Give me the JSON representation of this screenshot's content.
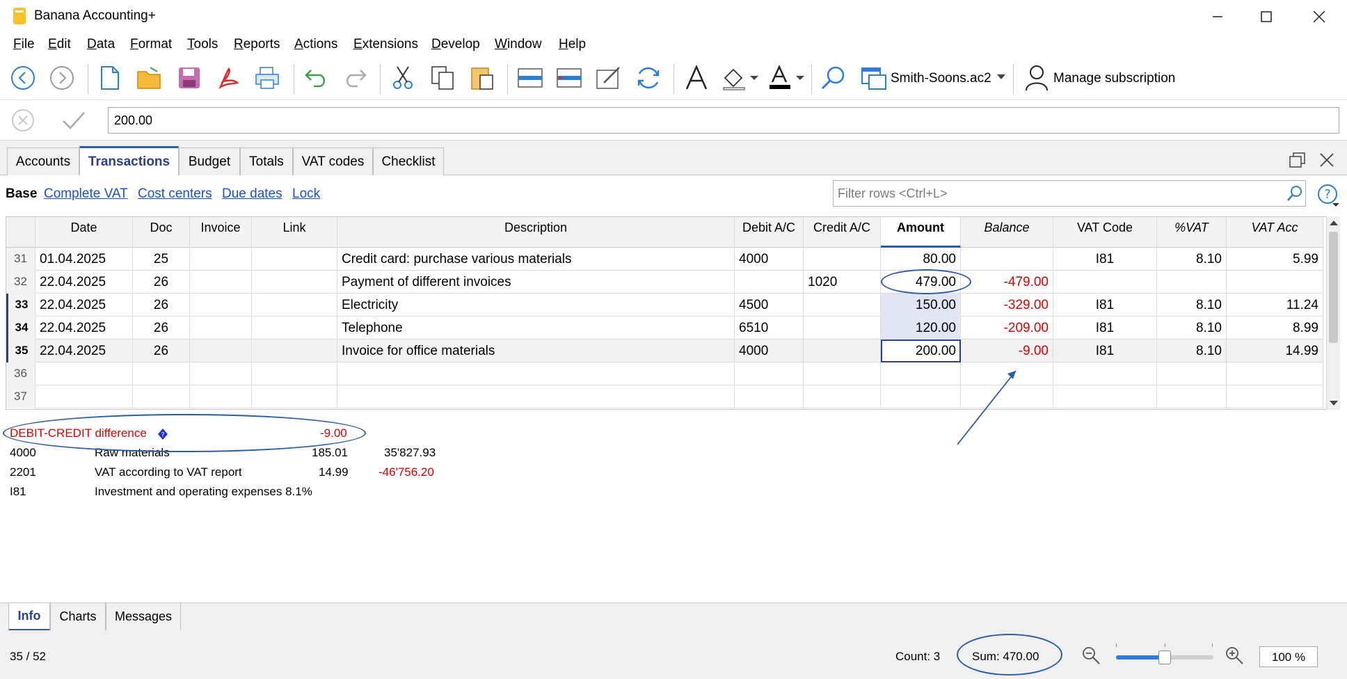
{
  "window": {
    "title": "Banana Accounting+"
  },
  "menu": [
    "File",
    "Edit",
    "Data",
    "Format",
    "Tools",
    "Reports",
    "Actions",
    "Extensions",
    "Develop",
    "Window",
    "Help"
  ],
  "toolbar": {
    "file_name": "Smith-Soons.ac2",
    "subscription": "Manage subscription"
  },
  "edit_value": "200.00",
  "tabs": [
    "Accounts",
    "Transactions",
    "Budget",
    "Totals",
    "VAT codes",
    "Checklist"
  ],
  "views": {
    "base": "Base",
    "links": [
      "Complete VAT",
      "Cost centers",
      "Due dates",
      "Lock"
    ]
  },
  "filter_placeholder": "Filter rows <Ctrl+L>",
  "table": {
    "columns": [
      "Date",
      "Doc",
      "Invoice",
      "Link",
      "Description",
      "Debit A/C",
      "Credit A/C",
      "Amount",
      "Balance",
      "VAT Code",
      "%VAT",
      "VAT Acc"
    ],
    "rows": [
      {
        "num": "31",
        "date": "01.04.2025",
        "doc": "25",
        "invoice": "",
        "link": "",
        "desc": "Credit card: purchase various materials",
        "debit": "4000",
        "credit": "",
        "amount": "80.00",
        "balance": "",
        "vat": "I81",
        "pct": "8.10",
        "vatacc": "5.99"
      },
      {
        "num": "32",
        "date": "22.04.2025",
        "doc": "26",
        "invoice": "",
        "link": "",
        "desc": "Payment of different invoices",
        "debit": "",
        "credit": "1020",
        "amount": "479.00",
        "balance": "-479.00",
        "vat": "",
        "pct": "",
        "vatacc": ""
      },
      {
        "num": "33",
        "date": "22.04.2025",
        "doc": "26",
        "invoice": "",
        "link": "",
        "desc": "Electricity",
        "debit": "4500",
        "credit": "",
        "amount": "150.00",
        "balance": "-329.00",
        "vat": "I81",
        "pct": "8.10",
        "vatacc": "11.24"
      },
      {
        "num": "34",
        "date": "22.04.2025",
        "doc": "26",
        "invoice": "",
        "link": "",
        "desc": "Telephone",
        "debit": "6510",
        "credit": "",
        "amount": "120.00",
        "balance": "-209.00",
        "vat": "I81",
        "pct": "8.10",
        "vatacc": "8.99"
      },
      {
        "num": "35",
        "date": "22.04.2025",
        "doc": "26",
        "invoice": "",
        "link": "",
        "desc": "Invoice for office materials",
        "debit": "4000",
        "credit": "",
        "amount": "200.00",
        "balance": "-9.00",
        "vat": "I81",
        "pct": "8.10",
        "vatacc": "14.99"
      },
      {
        "num": "36",
        "date": "",
        "doc": "",
        "invoice": "",
        "link": "",
        "desc": "",
        "debit": "",
        "credit": "",
        "amount": "",
        "balance": "",
        "vat": "",
        "pct": "",
        "vatacc": ""
      },
      {
        "num": "37",
        "date": "",
        "doc": "",
        "invoice": "",
        "link": "",
        "desc": "",
        "debit": "",
        "credit": "",
        "amount": "",
        "balance": "",
        "vat": "",
        "pct": "",
        "vatacc": ""
      }
    ]
  },
  "info": {
    "diff_label": "DEBIT-CREDIT difference",
    "diff_value": "-9.00",
    "lines": [
      {
        "code": "4000",
        "name": "Raw materials",
        "v1": "185.01",
        "v2": "35'827.93"
      },
      {
        "code": "2201",
        "name": "VAT according to VAT report",
        "v1": "14.99",
        "v2": "-46'756.20"
      },
      {
        "code": "I81",
        "name": "Investment and operating expenses 8.1%",
        "v1": "",
        "v2": ""
      }
    ]
  },
  "bottom_tabs": [
    "Info",
    "Charts",
    "Messages"
  ],
  "status": {
    "position": "35 / 52",
    "count": "Count: 3",
    "sum": "Sum: 470.00",
    "zoom": "100 %",
    "zoom_level": 0.5
  },
  "colors": {
    "accent": "#2a5caa",
    "negative": "#e00000",
    "link": "#1a4fd6"
  }
}
